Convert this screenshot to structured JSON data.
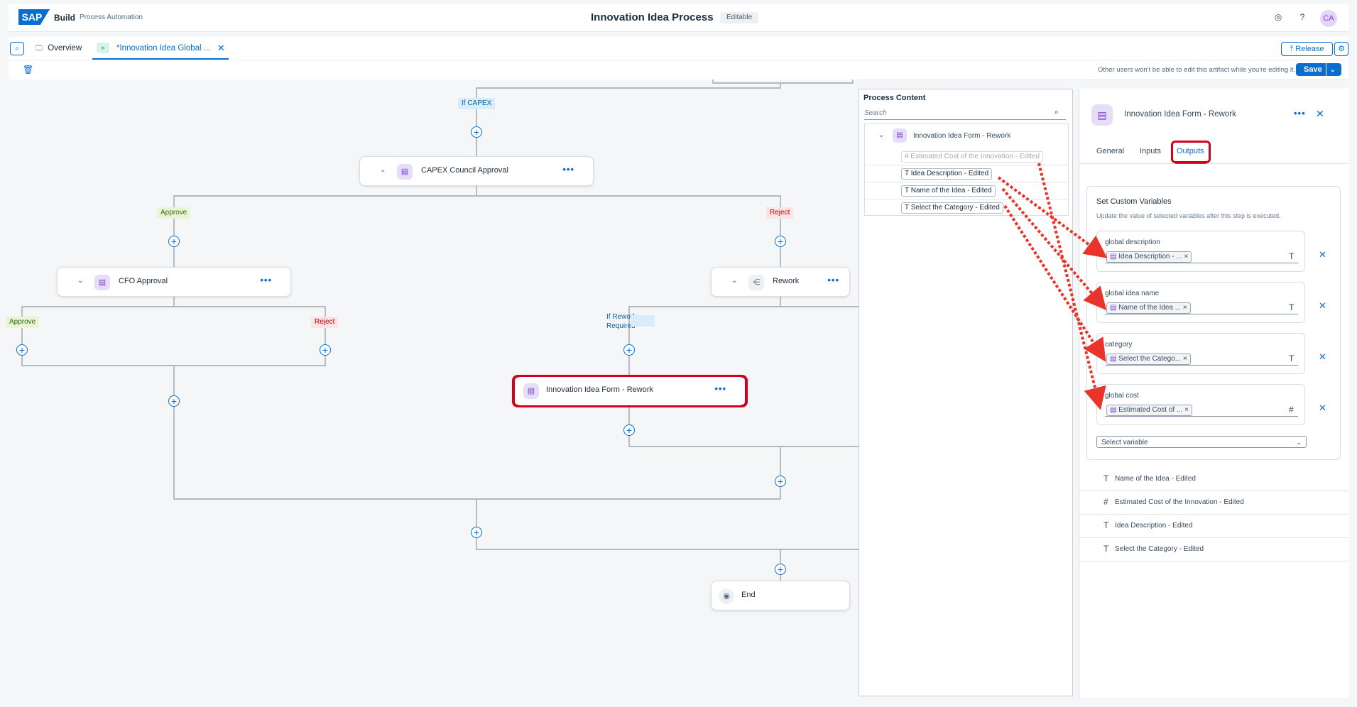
{
  "shell": {
    "logo": "SAP",
    "product": "Build",
    "subproduct": "Process Automation",
    "title": "Innovation Idea Process",
    "badge": "Editable",
    "avatar": "CA"
  },
  "tabs": {
    "overview": "Overview",
    "active": "*Innovation Idea Global ...",
    "release": "Release"
  },
  "toolbar": {
    "lock_note": "Other users won't be able to edit this artifact while you're editing it.",
    "save": "Save"
  },
  "canvas": {
    "labels": {
      "if_capex": "If CAPEX",
      "approve1": "Approve",
      "reject1": "Reject",
      "approve2": "Approve",
      "reject2": "Reject",
      "if_rework_1": "If Rework",
      "if_rework_2": "Required"
    },
    "nodes": {
      "capex": "CAPEX Council Approval",
      "cfo": "CFO Approval",
      "rework": "Rework",
      "form_rework": "Innovation Idea Form - Rework",
      "end": "End"
    }
  },
  "process_content": {
    "title": "Process Content",
    "search_placeholder": "Search",
    "root": "Innovation Idea Form - Rework",
    "items": [
      {
        "type": "#",
        "label": "Estimated Cost of the Innovation - Edited",
        "dimmed": true
      },
      {
        "type": "T",
        "label": "Idea Description - Edited"
      },
      {
        "type": "T",
        "label": "Name of the Idea - Edited"
      },
      {
        "type": "T",
        "label": "Select the Category - Edited"
      }
    ]
  },
  "properties": {
    "title": "Innovation Idea Form - Rework",
    "tabs": [
      "General",
      "Inputs",
      "Outputs"
    ],
    "active_tab": "Outputs",
    "custom_vars": {
      "title": "Set Custom Variables",
      "subtitle": "Update the value of selected variables after this step is executed.",
      "vars": [
        {
          "name": "global description",
          "chip": "Idea Description - ...",
          "type": "T"
        },
        {
          "name": "global idea name",
          "chip": "Name of the Idea ...",
          "type": "T"
        },
        {
          "name": "category",
          "chip": "Select the Catego...",
          "type": "T"
        },
        {
          "name": "global cost",
          "chip": "Estimated Cost of ...",
          "type": "#"
        }
      ],
      "select_placeholder": "Select variable"
    },
    "outputs": [
      {
        "type": "T",
        "label": "Name of the Idea - Edited"
      },
      {
        "type": "#",
        "label": "Estimated Cost of the Innovation - Edited"
      },
      {
        "type": "T",
        "label": "Idea Description - Edited"
      },
      {
        "type": "T",
        "label": "Select the Category - Edited"
      }
    ]
  },
  "colors": {
    "accent": "#0a6ed1",
    "highlight": "#d1001c",
    "arrow": "#e8342b"
  }
}
